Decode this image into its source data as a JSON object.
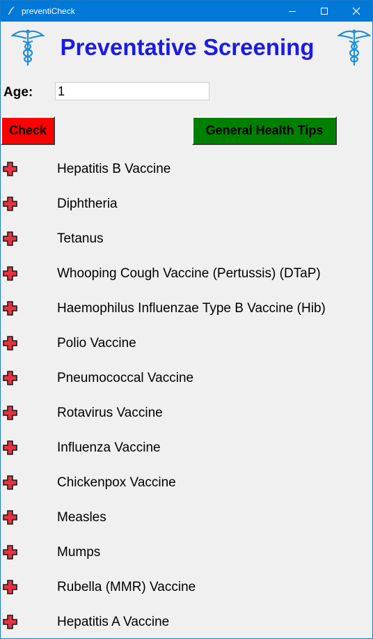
{
  "window": {
    "title": "preventiCheck"
  },
  "header": {
    "title": "Preventative Screening"
  },
  "age": {
    "label": "Age:",
    "value": "1"
  },
  "buttons": {
    "check": "Check",
    "tips": "General Health Tips"
  },
  "colors": {
    "title": "#1a1ae8",
    "check_button": "#ff0000",
    "tips_button": "#008000",
    "cross": "#e8313f",
    "caduceus": "#1f8fd6"
  },
  "icons": {
    "logo": "caduceus-icon",
    "list_marker": "red-cross-icon"
  },
  "screenings": [
    "Hepatitis B Vaccine",
    "Diphtheria",
    "Tetanus",
    "Whooping Cough Vaccine (Pertussis) (DTaP)",
    "Haemophilus Influenzae Type B Vaccine (Hib)",
    "Polio Vaccine",
    "Pneumococcal Vaccine",
    "Rotavirus Vaccine",
    "Influenza Vaccine",
    "Chickenpox Vaccine",
    "Measles",
    "Mumps",
    "Rubella (MMR) Vaccine",
    "Hepatitis A Vaccine"
  ]
}
